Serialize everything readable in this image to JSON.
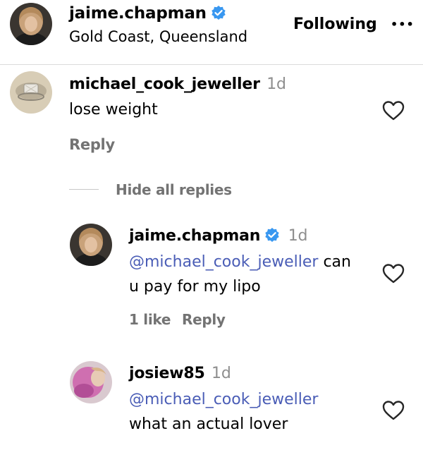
{
  "header": {
    "username": "jaime.chapman",
    "location": "Gold Coast, Queensland",
    "follow_label": "Following",
    "more_label": "•••"
  },
  "comment": {
    "username": "michael_cook_jeweller",
    "time": "1d",
    "text": "lose weight",
    "reply_label": "Reply",
    "hide_replies_label": "Hide all replies"
  },
  "replies": [
    {
      "username": "jaime.chapman",
      "time": "1d",
      "mention": "@michael_cook_jeweller",
      "text_after_mention": " can",
      "text_line2": "u pay for my lipo",
      "likes_label": "1 like",
      "reply_label": "Reply"
    },
    {
      "username": "josiew85",
      "time": "1d",
      "mention": "@michael_cook_jeweller",
      "text_line2": "what an actual lover"
    }
  ],
  "colors": {
    "verified": "#3897f0",
    "mention": "#4a5db6",
    "muted": "#737373"
  }
}
